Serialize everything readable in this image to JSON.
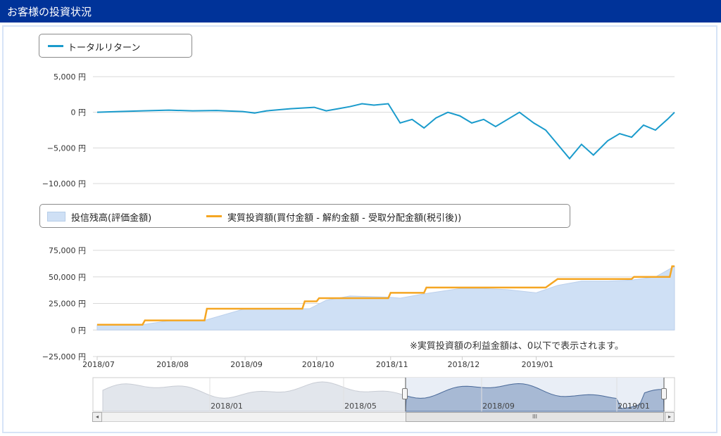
{
  "header": {
    "title": "お客様の投資状況"
  },
  "legend1": {
    "item": "トータルリターン"
  },
  "legend2": {
    "area_item": "投信残高(評価金額)",
    "line_item": "実質投資額(買付金額 - 解約金額 - 受取分配金額(税引後))"
  },
  "note": "※実質投資額の利益金額は、0以下で表示されます。",
  "colors": {
    "header_bg": "#003399",
    "return_line": "#1a9bcc",
    "area_fill": "#cfe0f5",
    "invest_line": "#f5a623",
    "navigator_fill": "#a7b9d4",
    "navigator_line": "#4a6a9a"
  },
  "chart_data": [
    {
      "type": "line",
      "series": [
        {
          "name": "トータルリターン",
          "x": [
            "2018/07/01",
            "2018/07/10",
            "2018/07/20",
            "2018/07/31",
            "2018/08/10",
            "2018/08/20",
            "2018/08/31",
            "2018/09/05",
            "2018/09/10",
            "2018/09/20",
            "2018/09/30",
            "2018/10/05",
            "2018/10/10",
            "2018/10/15",
            "2018/10/20",
            "2018/10/25",
            "2018/10/31",
            "2018/11/05",
            "2018/11/10",
            "2018/11/15",
            "2018/11/20",
            "2018/11/25",
            "2018/11/30",
            "2018/12/05",
            "2018/12/10",
            "2018/12/15",
            "2018/12/20",
            "2018/12/25",
            "2018/12/31",
            "2019/01/05",
            "2019/01/10",
            "2019/01/15",
            "2019/01/20",
            "2019/01/25",
            "2019/01/31",
            "2019/02/05",
            "2019/02/10",
            "2019/02/15",
            "2019/02/20",
            "2019/02/25",
            "2019/02/28"
          ],
          "values": [
            0,
            100,
            200,
            300,
            200,
            250,
            100,
            -100,
            200,
            500,
            700,
            200,
            500,
            800,
            1200,
            1000,
            1200,
            -1500,
            -1000,
            -2200,
            -800,
            0,
            -500,
            -1500,
            -1000,
            -2000,
            -1000,
            0,
            -1500,
            -2500,
            -4500,
            -6500,
            -4500,
            -6000,
            -4000,
            -3000,
            -3500,
            -1800,
            -2500,
            -1000,
            0
          ]
        }
      ],
      "yticks": [
        "5,000 円",
        "0 円",
        "−5,000 円",
        "−10,000 円"
      ],
      "ylim": [
        -10000,
        5000
      ]
    },
    {
      "type": "area",
      "categories": [
        "2018/07",
        "2018/08",
        "2018/09",
        "2018/10",
        "2018/11",
        "2018/12",
        "2019/01"
      ],
      "series": [
        {
          "name": "投信残高(評価金額)",
          "x": [
            "2018/07/01",
            "2018/07/20",
            "2018/08/01",
            "2018/08/15",
            "2018/09/01",
            "2018/09/15",
            "2018/09/28",
            "2018/10/05",
            "2018/10/15",
            "2018/10/31",
            "2018/11/05",
            "2018/11/15",
            "2018/11/30",
            "2018/12/10",
            "2018/12/20",
            "2019/01/01",
            "2019/01/10",
            "2019/01/20",
            "2019/01/31",
            "2019/02/10",
            "2019/02/20",
            "2019/02/28"
          ],
          "values": [
            5000,
            5000,
            9000,
            9000,
            20000,
            20000,
            20000,
            28000,
            32000,
            31000,
            30000,
            34000,
            39000,
            39000,
            38000,
            35000,
            42000,
            46000,
            46000,
            47000,
            50000,
            60000
          ]
        },
        {
          "name": "実質投資額(買付金額 - 解約金額 - 受取分配金額(税引後))",
          "x": [
            "2018/07/01",
            "2018/07/20",
            "2018/07/21",
            "2018/08/15",
            "2018/08/16",
            "2018/09/25",
            "2018/09/26",
            "2018/10/01",
            "2018/10/02",
            "2018/10/31",
            "2018/11/01",
            "2018/11/15",
            "2018/11/16",
            "2019/01/05",
            "2019/01/10",
            "2019/02/10",
            "2019/02/11",
            "2019/02/26",
            "2019/02/27",
            "2019/02/28"
          ],
          "values": [
            5000,
            5000,
            9000,
            9000,
            20000,
            20000,
            27000,
            27000,
            30000,
            30000,
            35000,
            35000,
            40000,
            40000,
            48000,
            48000,
            50000,
            50000,
            60000,
            60000
          ]
        }
      ],
      "yticks": [
        "75,000 円",
        "50,000 円",
        "25,000 円",
        "0 円",
        "−25,000 円"
      ],
      "ylim": [
        -25000,
        75000
      ]
    },
    {
      "type": "area",
      "categories": [
        "2018/01",
        "2018/05",
        "2018/09",
        "2019/01"
      ]
    }
  ]
}
